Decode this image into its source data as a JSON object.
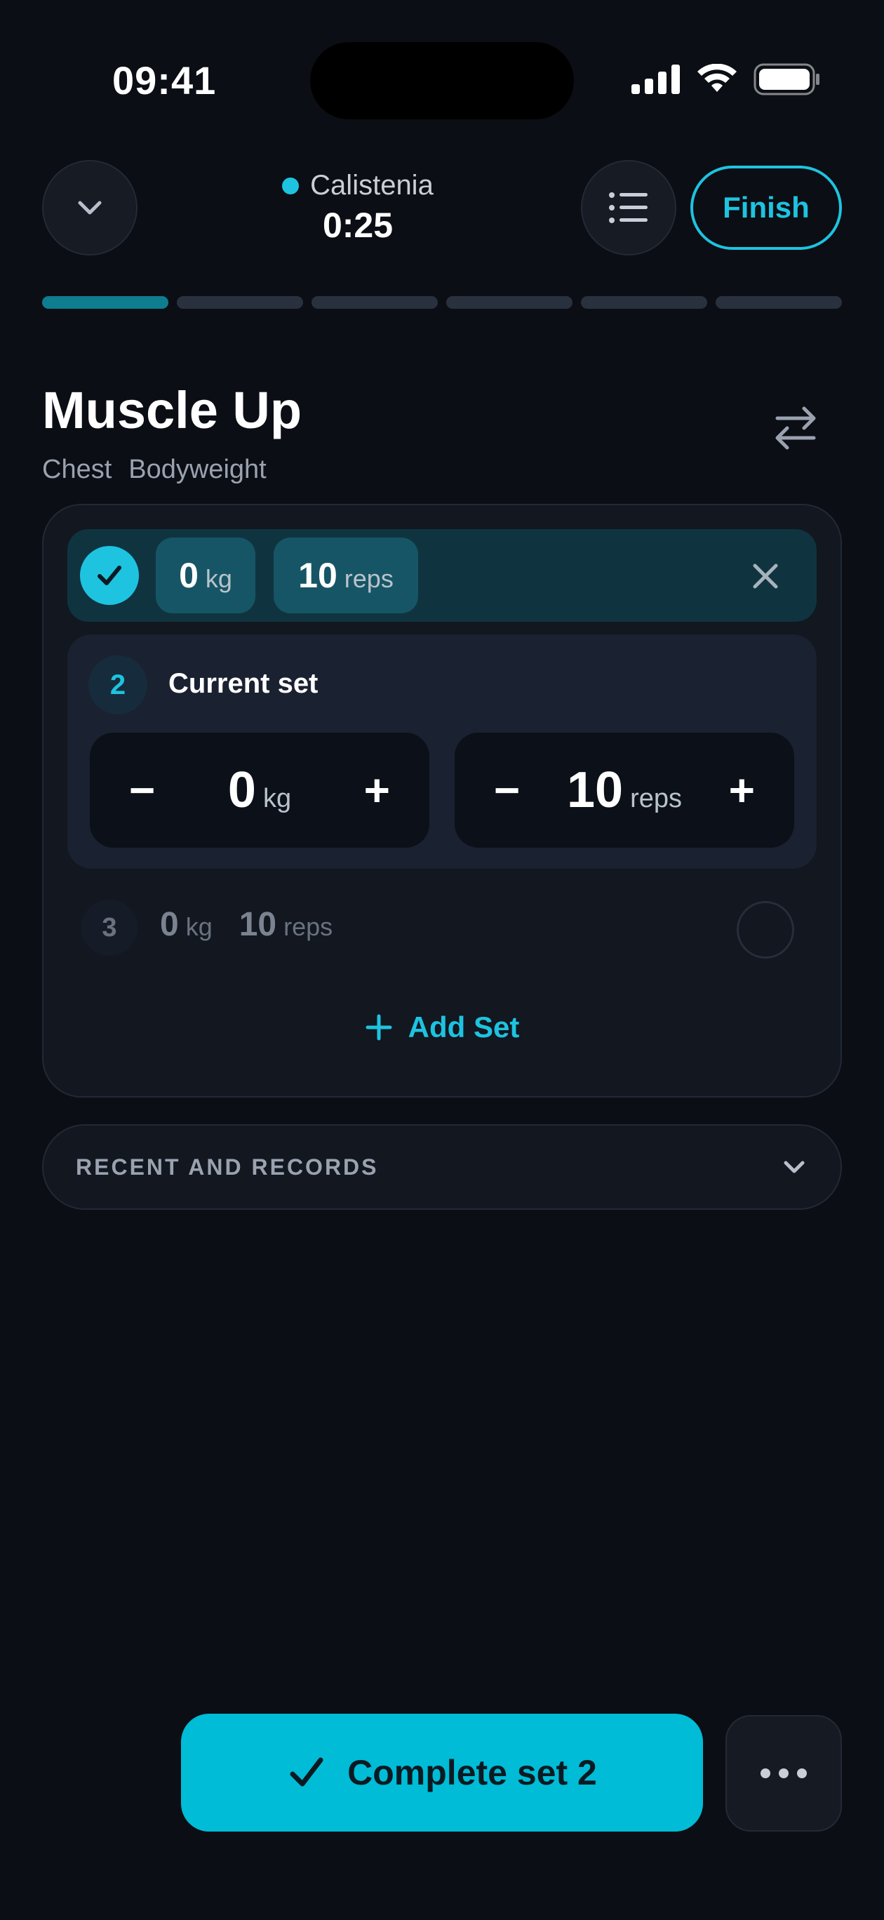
{
  "status_bar": {
    "time": "09:41"
  },
  "header": {
    "workout_name": "Calistenia",
    "timer": "0:25",
    "finish_label": "Finish"
  },
  "progress": {
    "total_segments": 6,
    "active_index": 0
  },
  "exercise": {
    "title": "Muscle Up",
    "tags": [
      "Chest",
      "Bodyweight"
    ]
  },
  "sets": {
    "completed": {
      "weight": "0",
      "weight_unit": "kg",
      "reps": "10",
      "reps_unit": "reps"
    },
    "current": {
      "number": "2",
      "label": "Current set",
      "weight": "0",
      "weight_unit": "kg",
      "reps": "10",
      "reps_unit": "reps",
      "minus": "−",
      "plus": "+"
    },
    "upcoming": {
      "number": "3",
      "weight": "0",
      "weight_unit": "kg",
      "reps": "10",
      "reps_unit": "reps"
    },
    "add_set_label": "Add Set"
  },
  "recent": {
    "label": "RECENT AND RECORDS"
  },
  "bottom": {
    "complete_label": "Complete set 2"
  },
  "colors": {
    "accent": "#1ec3e0",
    "background": "#0b0e14",
    "button": "#00bcd6"
  }
}
